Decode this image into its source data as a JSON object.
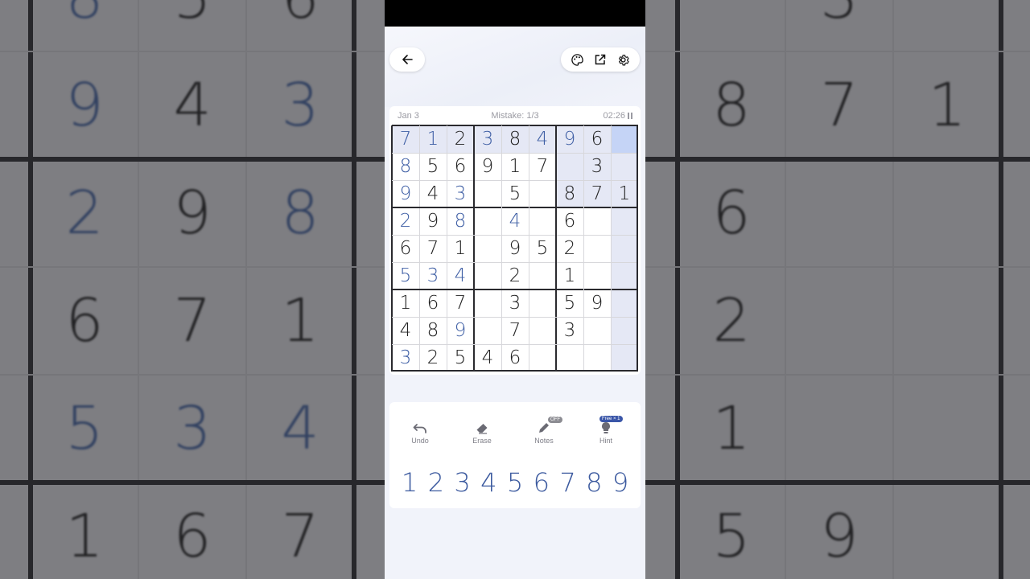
{
  "colors": {
    "accent": "#3f5fa5",
    "given_digit": "#3f5fa5",
    "entered_digit": "#222222",
    "selected_cell": "#c5d4f6",
    "highlight_cell": "#e5e8f5"
  },
  "icons": {
    "back": "arrow-left-icon",
    "theme": "palette-icon",
    "share": "open-external-icon",
    "settings": "gear-icon",
    "undo": "undo-icon",
    "erase": "eraser-icon",
    "notes": "pencil-icon",
    "hint": "lightbulb-icon"
  },
  "header": {
    "date": "Jan 3",
    "mistakes": "Mistake: 1/3",
    "timer": "02:26"
  },
  "board": {
    "values": [
      [
        "7",
        "1",
        "2",
        "3",
        "8",
        "4",
        "9",
        "6",
        ""
      ],
      [
        "8",
        "5",
        "6",
        "9",
        "1",
        "7",
        "",
        "3",
        ""
      ],
      [
        "9",
        "4",
        "3",
        "",
        "5",
        "",
        "8",
        "7",
        "1"
      ],
      [
        "2",
        "9",
        "8",
        "",
        "4",
        "",
        "6",
        "",
        ""
      ],
      [
        "6",
        "7",
        "1",
        "",
        "9",
        "5",
        "2",
        "",
        ""
      ],
      [
        "5",
        "3",
        "4",
        "",
        "2",
        "",
        "1",
        "",
        ""
      ],
      [
        "1",
        "6",
        "7",
        "",
        "3",
        "",
        "5",
        "9",
        ""
      ],
      [
        "4",
        "8",
        "9",
        "",
        "7",
        "",
        "3",
        "",
        ""
      ],
      [
        "3",
        "2",
        "5",
        "4",
        "6",
        "",
        "",
        "",
        ""
      ]
    ],
    "given": [
      [
        1,
        1,
        0,
        1,
        0,
        1,
        1,
        0,
        0
      ],
      [
        1,
        0,
        0,
        0,
        0,
        0,
        0,
        0,
        0
      ],
      [
        1,
        0,
        1,
        0,
        0,
        0,
        0,
        0,
        0
      ],
      [
        1,
        0,
        1,
        0,
        1,
        0,
        0,
        0,
        0
      ],
      [
        0,
        0,
        0,
        0,
        0,
        0,
        0,
        0,
        0
      ],
      [
        1,
        1,
        1,
        0,
        0,
        0,
        0,
        0,
        0
      ],
      [
        0,
        0,
        0,
        0,
        0,
        0,
        0,
        0,
        0
      ],
      [
        0,
        0,
        1,
        0,
        0,
        0,
        0,
        0,
        0
      ],
      [
        1,
        0,
        0,
        0,
        0,
        0,
        0,
        0,
        0
      ]
    ],
    "selected": {
      "row": 0,
      "col": 8
    }
  },
  "controls": [
    {
      "id": "undo",
      "label": "Undo"
    },
    {
      "id": "erase",
      "label": "Erase"
    },
    {
      "id": "notes",
      "label": "Notes",
      "badge": "OFF"
    },
    {
      "id": "hint",
      "label": "Hint",
      "badge": "Free × 1"
    }
  ],
  "numpad": [
    "1",
    "2",
    "3",
    "4",
    "5",
    "6",
    "7",
    "8",
    "9"
  ]
}
